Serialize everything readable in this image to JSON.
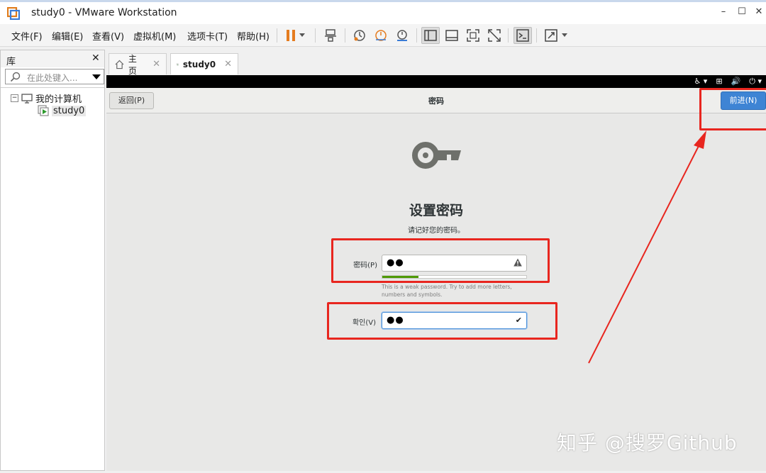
{
  "window": {
    "title": "study0 - VMware Workstation",
    "controls": {
      "minimize": "–",
      "maximize": "☐",
      "close": "✕"
    }
  },
  "menu": [
    "文件(F)",
    "编辑(E)",
    "查看(V)",
    "虚拟机(M)",
    "选项卡(T)",
    "帮助(H)"
  ],
  "toolbar": {
    "icons": [
      "pause-icon",
      "dropdown-icon",
      "send-ctrl-alt-del-icon",
      "snapshot-take-icon",
      "snapshot-revert-icon",
      "snapshot-manager-icon",
      "show-library-icon",
      "thumbnail-bar-icon",
      "full-screen-icon",
      "unity-icon",
      "console-view-icon",
      "stretch-guest-icon",
      "dropdown-icon"
    ],
    "accent": "#e57c1f"
  },
  "library": {
    "title": "库",
    "close": "✕",
    "search_placeholder": "在此处键入...",
    "tree": {
      "root_label": "我的计算机",
      "expander": "⊟",
      "children": [
        "study0"
      ]
    }
  },
  "tabs": [
    {
      "label": "主页",
      "icon": "home-icon",
      "close": "✕"
    },
    {
      "label": "study0",
      "icon": "vm-icon",
      "close": "✕",
      "active": true
    }
  ],
  "vm": {
    "back_label": "返回(P)",
    "page_title": "密码",
    "next_label": "前进(N)",
    "next_color": "#3e84d4",
    "setup_title": "设置密码",
    "setup_subtitle": "请记好您的密码。",
    "password": {
      "label": "密码(P)",
      "value": "●●",
      "warning_icon": "warning-icon",
      "strength": 0.25,
      "hint": "This is a weak password. Try to add more letters, numbers and symbols."
    },
    "confirm": {
      "label": "확인(V)",
      "value": "●●",
      "check_icon": "check-icon"
    }
  },
  "watermark": "知乎 @搜罗Github",
  "annotation_color": "#e8261f"
}
